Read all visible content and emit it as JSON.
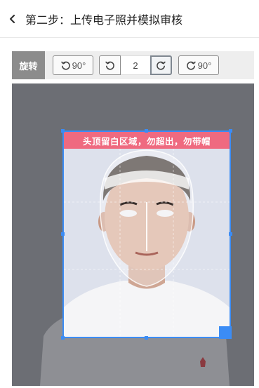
{
  "header": {
    "title": "第二步：上传电子照并模拟审核",
    "back_icon": "chevron-left-icon"
  },
  "toolbar": {
    "label": "旋转",
    "rotate_left_label": "90°",
    "rotate_right_label": "90°",
    "step_value": "2",
    "icons": {
      "rotate_left": "rotate-ccw-icon",
      "step_down": "undo-icon",
      "step_up": "redo-icon",
      "rotate_right": "rotate-cw-icon"
    }
  },
  "editor": {
    "banner_text": "头顶留白区域，勿超出，勿带帽",
    "colors": {
      "banner": "#ef6a80",
      "crop_border": "#3b8cf5",
      "canvas_bg": "#6b6d73"
    }
  }
}
